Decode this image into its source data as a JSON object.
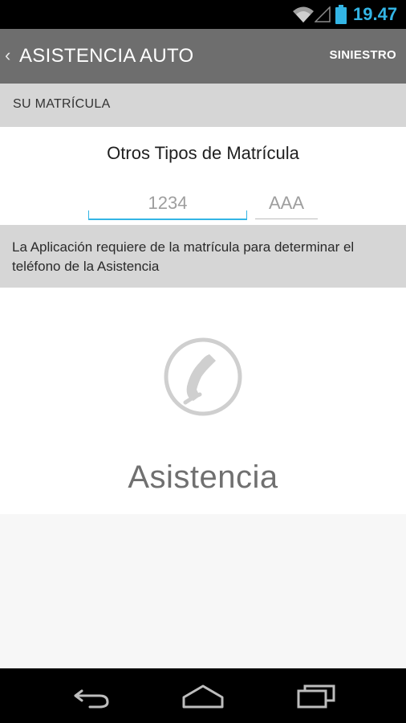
{
  "status_bar": {
    "time": "19.47",
    "accent_color": "#33b5e5",
    "icons": [
      "wifi-icon",
      "signal-icon",
      "battery-icon"
    ]
  },
  "action_bar": {
    "title": "ASISTENCIA AUTO",
    "action_label": "SINIESTRO",
    "background": "#6e6e6e"
  },
  "section_header": {
    "label": "SU MATRÍCULA"
  },
  "plate": {
    "other_types_link": "Otros Tipos de Matrícula",
    "number_placeholder": "1234",
    "number_value": "",
    "letters_placeholder": "AAA",
    "letters_value": ""
  },
  "info": {
    "message": "La Aplicación requiere de la matrícula para determinar el teléfono de la Asistencia"
  },
  "assistance": {
    "icon": "phone-icon",
    "label": "Asistencia"
  },
  "nav_bar": {
    "icons": [
      "back-icon",
      "home-icon",
      "recent-apps-icon"
    ]
  }
}
